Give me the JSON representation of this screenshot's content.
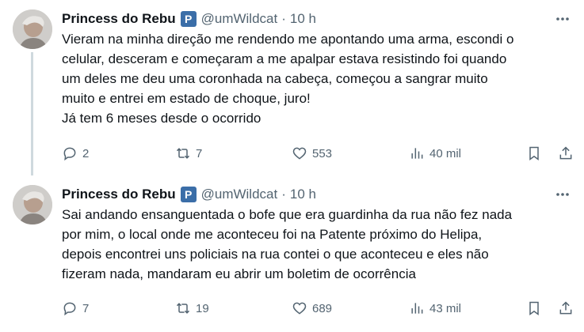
{
  "tweets": [
    {
      "author_name": "Princess do Rebu",
      "badge": "P",
      "handle": "@umWildcat",
      "separator": "·",
      "time": "10 h",
      "text_lines": [
        "Vieram na minha direção me rendendo me apontando uma arma, escondi o",
        "celular, desceram e começaram a me apalpar estava resistindo foi quando",
        "um deles me deu uma coronhada na cabeça, começou a sangrar muito",
        "muito e entrei em estado de choque, juro!",
        "Já tem 6 meses desde o ocorrido"
      ],
      "replies": "2",
      "retweets": "7",
      "likes": "553",
      "views": "40 mil"
    },
    {
      "author_name": "Princess do Rebu",
      "badge": "P",
      "handle": "@umWildcat",
      "separator": "·",
      "time": "10 h",
      "text_lines": [
        "Sai andando ensanguentada o bofe que era guardinha da rua não fez nada",
        "por mim, o local onde me aconteceu foi na Patente próximo do Helipa,",
        "depois encontrei uns policiais na rua contei o que aconteceu e eles não",
        "fizeram nada, mandaram eu abrir um boletim de ocorrência"
      ],
      "replies": "7",
      "retweets": "19",
      "likes": "689",
      "views": "43 mil"
    }
  ],
  "colors": {
    "text": "#0f1419",
    "secondary": "#536471",
    "badge": "#3b6ea8",
    "thread_line": "#cfd9de"
  },
  "icons": [
    "more-icon",
    "reply-icon",
    "retweet-icon",
    "like-icon",
    "views-icon",
    "bookmark-icon",
    "share-icon"
  ]
}
